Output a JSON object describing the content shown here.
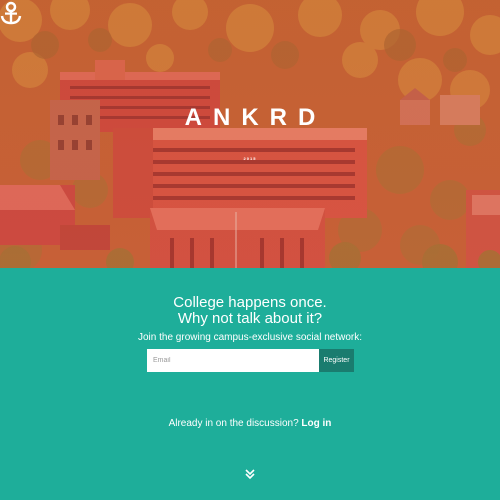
{
  "brand": {
    "name": "ANKRD",
    "logo_year": "2015",
    "logo_icon": "anchor-icon"
  },
  "hero": {
    "image": "campus-aerial-photo"
  },
  "signup": {
    "headline_line1": "College happens once.",
    "headline_line2": "Why not talk about it?",
    "subline": "Join the growing campus-exclusive social network:",
    "email_placeholder": "Email",
    "register_label": "Register"
  },
  "login": {
    "prompt": "Already in on the discussion?",
    "link_label": "Log in"
  },
  "scroll": {
    "icon": "double-chevron-down-icon"
  },
  "colors": {
    "teal": "#1eae9a",
    "button": "#1a7c6f",
    "hero_tint": "#e8524a"
  }
}
